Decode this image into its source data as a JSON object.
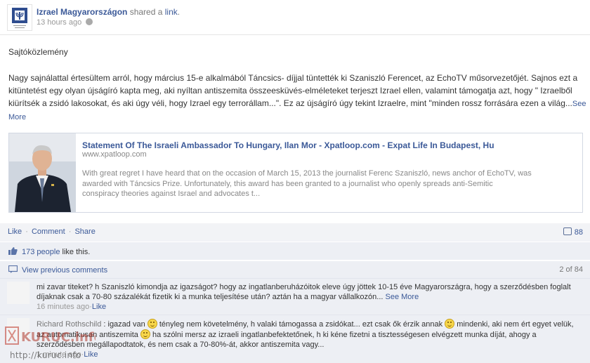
{
  "header": {
    "poster_name": "Izrael Magyarországon",
    "action": " shared a ",
    "action_link": "link",
    "action_end": ".",
    "timestamp": "13 hours ago"
  },
  "post": {
    "title": "Sajtóközlemény",
    "body": "Nagy sajnálattal értesültem arról, hogy március 15-e alkalmából Táncsics- díjjal tüntették ki Szaniszló Ferencet, az EchoTV műsorvezetőjét. Sajnos ezt a kitüntetést egy olyan újságíró kapta meg, aki nyíltan antiszemita összeesküvés-elméleteket terjeszt Izrael ellen, valamint támogatja azt, hogy \" Izraelből kiürítsék a zsidó lakosokat, és aki úgy véli, hogy Izrael egy terrorállam...\". Ez az újságíró úgy tekint Izraelre, mint \"minden rossz forrására ezen a világ...",
    "see_more": "See More"
  },
  "attachment": {
    "title": "Statement Of The Israeli Ambassador To Hungary, Ilan Mor - Xpatloop.com - Expat Life In Budapest, Hu",
    "url": "www.xpatloop.com",
    "description": "With great regret I have heard that on the occasion of March 15, 2013 the journalist Ferenc Szaniszló, news anchor of EchoTV, was awarded with Táncsics Prize. Unfortunately, this award has been granted to a journalist who openly spreads anti-Semitic conspiracy theories against Israel and advocates t..."
  },
  "actions": {
    "like": "Like",
    "comment": "Comment",
    "share": "Share",
    "sep": "·",
    "comment_count": "88"
  },
  "likes": {
    "count": "173 people",
    "suffix": " like this."
  },
  "comments_nav": {
    "view_previous": "View previous comments",
    "page": "2 of 84"
  },
  "comments": [
    {
      "author": "",
      "text": "mi zavar titeket? h Szaniszló kimondja az igazságot? hogy az ingatlanberuházóitok eleve úgy jöttek 10-15 éve Magyarországra, hogy a szerződésben foglalt díjaknak csak a 70-80 százalékát fizetik ki a munka teljesítése után? aztán ha a magyar vállalkozón...",
      "see_more": "See More",
      "time": "16 minutes ago",
      "like": "Like"
    },
    {
      "author": "Richard Rothschild",
      "text_a": " : igazad van ",
      "text_b": " tényleg nem követelmény, h valaki támogassa a zsidókat... ezt csak ők érzik annak ",
      "text_c": " mindenki, aki nem ért egyet velük, az automatikusan antiszemita ",
      "text_d": " ha szólni mersz az izraeli ingatlanbefektetőnek, h ki kéne fizetni a tisztességesen elvégzett munka díját, ahogy a szerződésben megállapodtatok, és nem csak a 70-80%-át, akkor antiszemita vagy...",
      "time": "1 minute ago",
      "like": "Like"
    }
  ],
  "watermark": {
    "logo_text": "KURUC.info",
    "url": "http://kuruc.info"
  },
  "colors": {
    "link": "#3b5998",
    "ufi_bg": "#edeff4",
    "action_bar_bg": "#f2f3f6"
  }
}
